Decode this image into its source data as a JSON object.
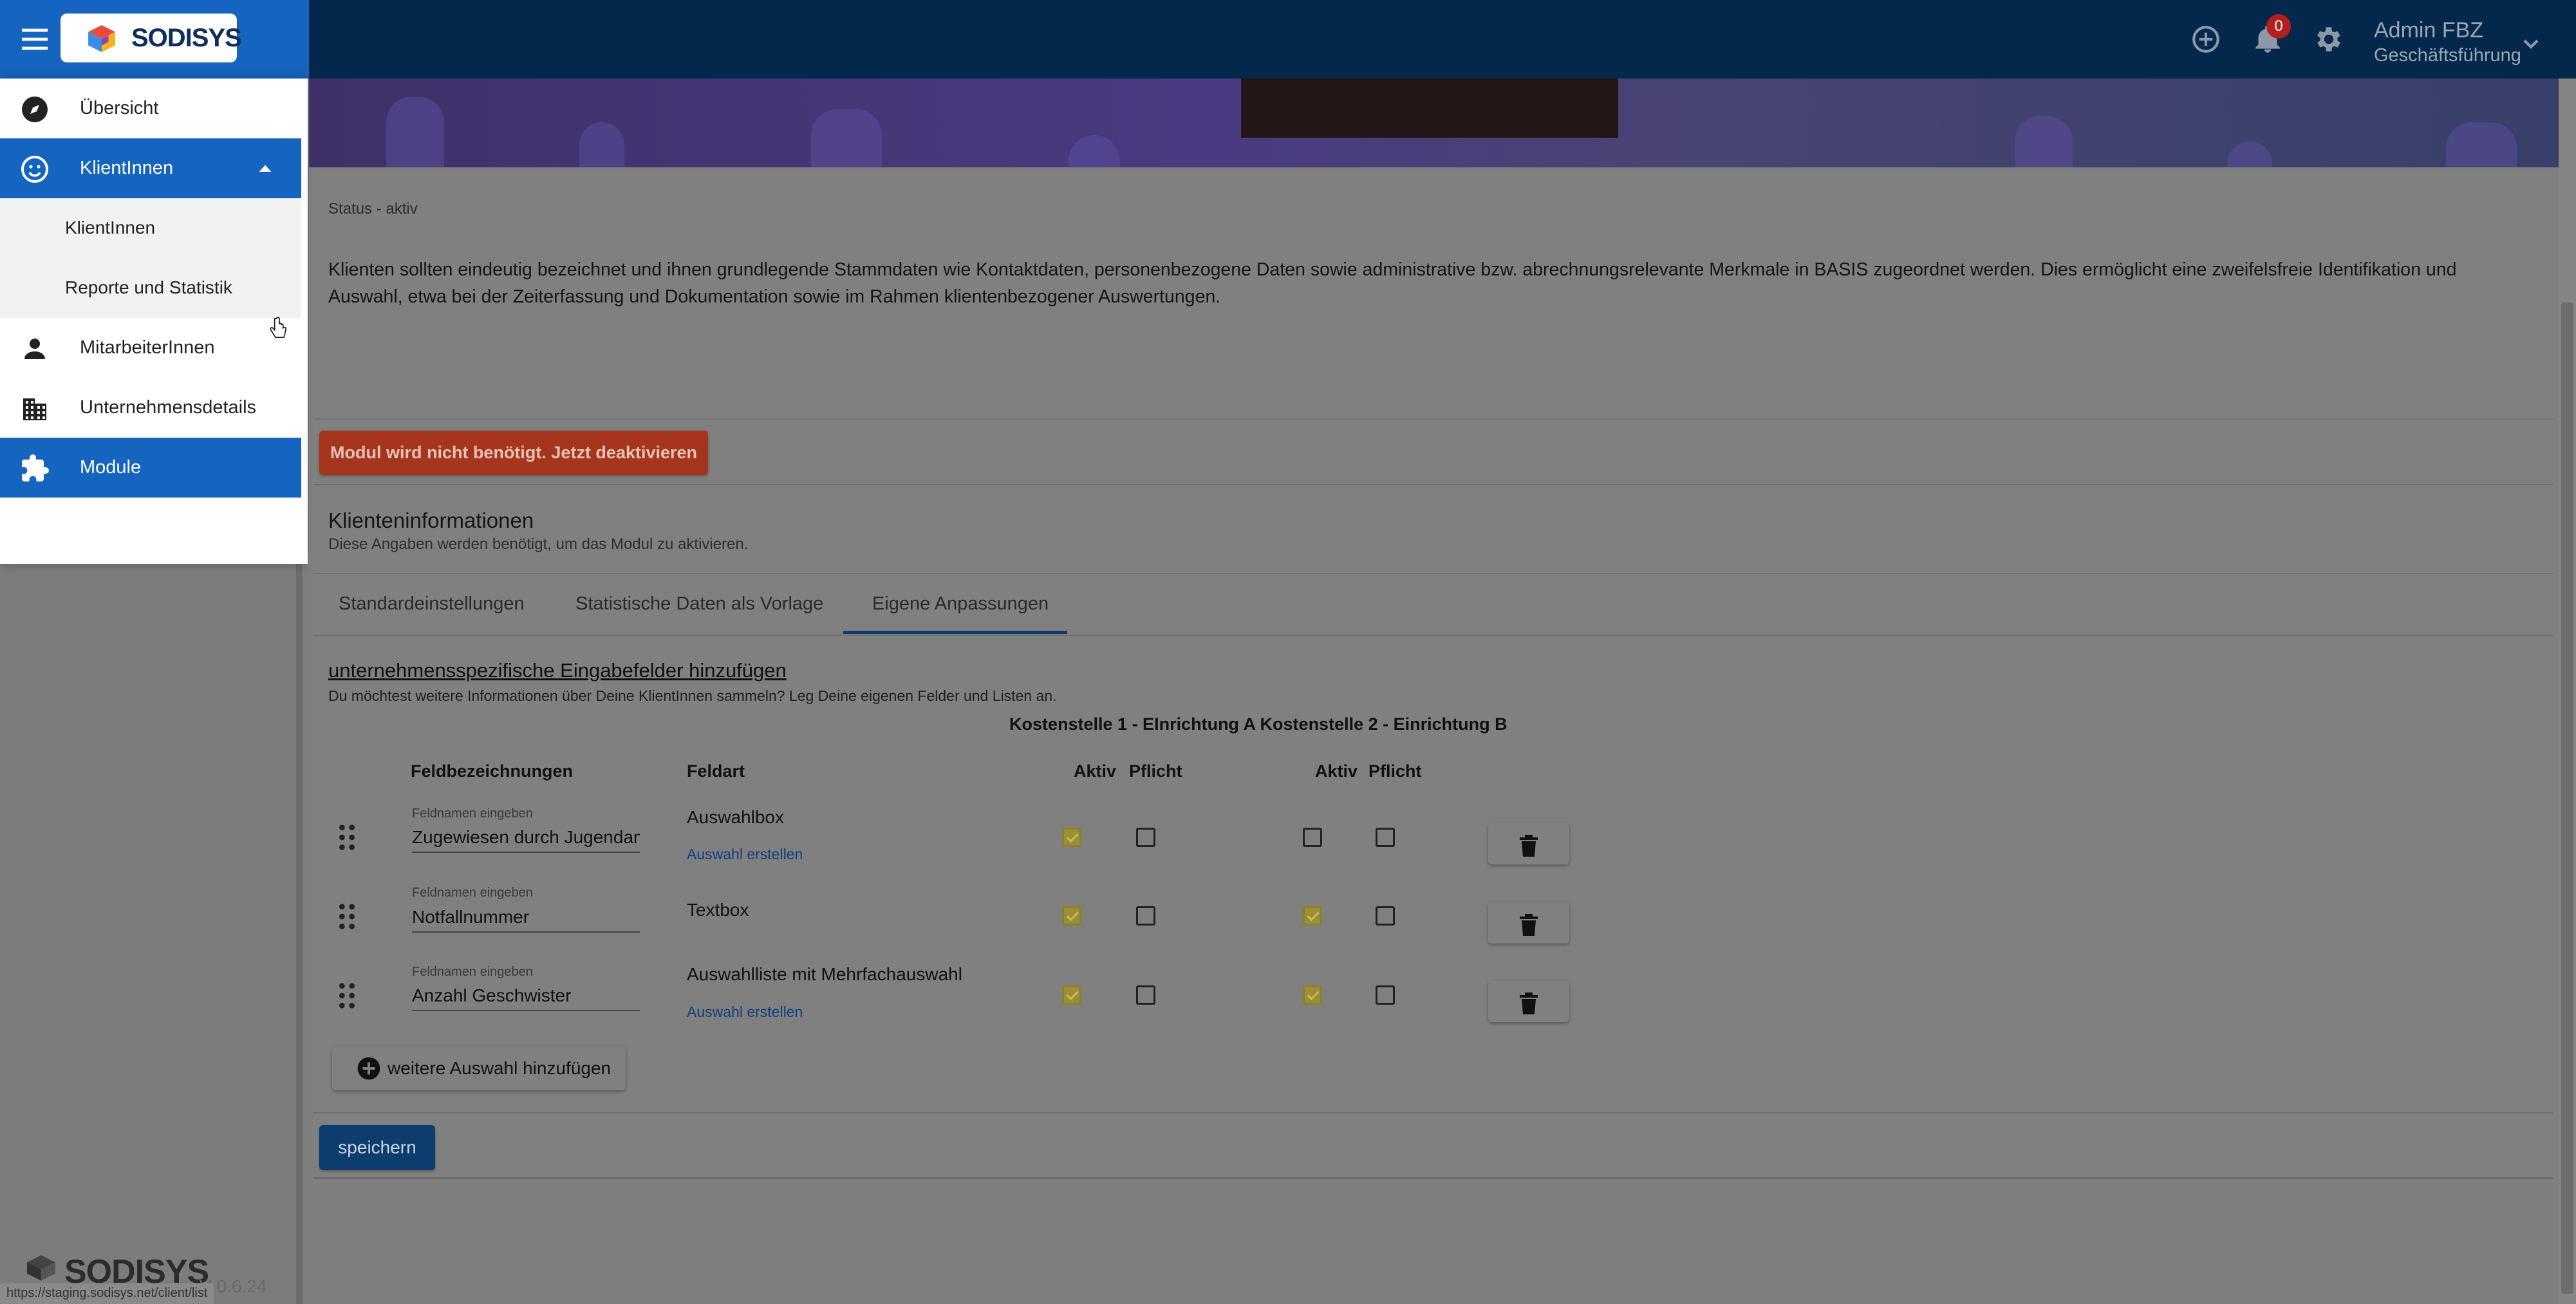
{
  "header": {
    "notifications_count": "0",
    "user_name": "Admin FBZ",
    "user_role": "Geschäftsführung",
    "icons": [
      "add-circle-icon",
      "bell-icon",
      "gear-icon",
      "chevron-down-icon"
    ]
  },
  "brand": {
    "logo_text": "SODISYS"
  },
  "sidebar": {
    "items": [
      {
        "label": "Übersicht",
        "icon": "compass-icon"
      },
      {
        "label": "KlientInnen",
        "icon": "smiley-icon",
        "expanded": true
      },
      {
        "label": "MitarbeiterInnen",
        "icon": "person-icon"
      },
      {
        "label": "Unternehmensdetails",
        "icon": "building-icon"
      },
      {
        "label": "Module",
        "icon": "puzzle-icon",
        "active": true
      }
    ],
    "subitems": [
      {
        "label": "KlientInnen"
      },
      {
        "label": "Reporte und Statistik"
      }
    ],
    "footer_logo": "SODISYS",
    "version": "V 0.6.24"
  },
  "status_url": "https://staging.sodisys.net/client/list",
  "module": {
    "status": "Status - aktiv",
    "description": "Klienten sollten eindeutig bezeichnet und ihnen grundlegende Stammdaten wie Kontaktdaten, personenbezogene Daten sowie administrative bzw. abrechnungsrelevante Merkmale in BASIS zugeordnet werden. Dies ermöglicht eine zweifelsfreie Identifikation und Auswahl, etwa bei der Zeiterfassung und Dokumentation sowie im Rahmen klientenbezogener Auswertungen.",
    "deactivate_label": "Modul wird nicht benötigt. Jetzt deaktivieren"
  },
  "info": {
    "title": "Klienteninformationen",
    "subtitle": "Diese Angaben werden benötigt, um das Modul zu aktivieren."
  },
  "tabs": [
    {
      "label": "Standardeinstellungen"
    },
    {
      "label": "Statistische Daten als Vorlage"
    },
    {
      "label": "Eigene Anpassungen",
      "active": true
    }
  ],
  "custom_fields": {
    "title": "unternehmensspezifische Eingabefelder hinzufügen",
    "hint": "Du möchtest weitere Informationen über Deine KlientInnen sammeln? Leg Deine eigenen Felder und Listen an.",
    "cost_centers": "Kostenstelle 1 - EInrichtung A Kostenstelle 2 - Einrichtung B",
    "headers": {
      "field_names": "Feldbezeichnungen",
      "field_type": "Feldart",
      "active_1": "Aktiv",
      "required_1": "Pflicht",
      "active_2": "Aktiv",
      "required_2": "Pflicht"
    },
    "rows": [
      {
        "label": "Feldnamen eingeben",
        "value": "Zugewiesen durch Jugendamt",
        "type": "Auswahlbox",
        "link": "Auswahl erstellen",
        "active1": true,
        "required1": false,
        "active2": false,
        "required2": false
      },
      {
        "label": "Feldnamen eingeben",
        "value": "Notfallnummer",
        "type": "Textbox",
        "link": "",
        "active1": true,
        "required1": false,
        "active2": true,
        "required2": false
      },
      {
        "label": "Feldnamen eingeben",
        "value": "Anzahl Geschwister",
        "type": "Auswahlliste mit Mehrfachauswahl",
        "link": "Auswahl erstellen",
        "active1": true,
        "required1": false,
        "active2": true,
        "required2": false
      }
    ],
    "add_label": "weitere Auswahl hinzufügen",
    "save_label": "speichern"
  },
  "colors": {
    "accent": "#1565c0",
    "topbar": "#04284c",
    "danger": "#a5361d"
  }
}
